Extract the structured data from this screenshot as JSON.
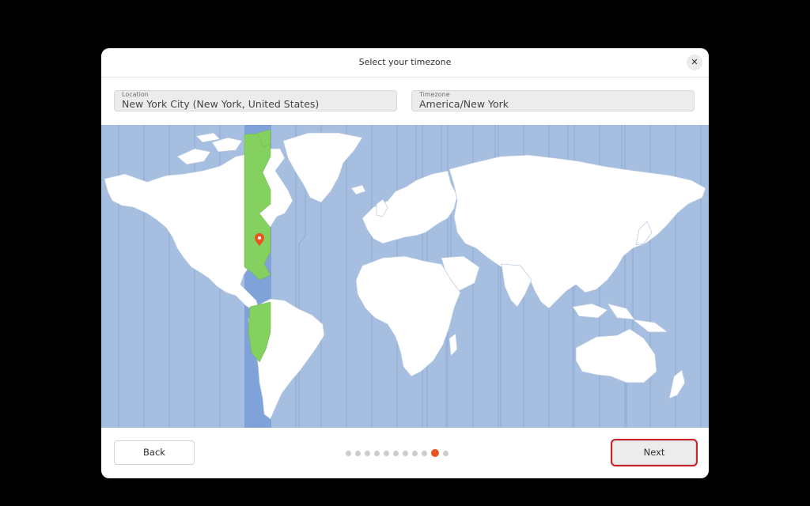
{
  "dialog": {
    "title": "Select your timezone",
    "close_icon": "close-icon"
  },
  "location": {
    "label": "Location",
    "value": "New York City (New York, United States)"
  },
  "timezone": {
    "label": "Timezone",
    "value": "America/New York"
  },
  "map": {
    "selected_marker_icon": "map-pin-icon",
    "colors": {
      "ocean": "#a6bfe0",
      "land": "#ffffff",
      "selected_zone_band": "#7b9fd8",
      "selected_zone_land": "#85d160",
      "marker": "#e95420"
    }
  },
  "footer": {
    "back_label": "Back",
    "next_label": "Next",
    "progress": {
      "total_steps": 11,
      "current_step": 10
    }
  },
  "colors": {
    "accent": "#e95420",
    "highlight_outline": "#d0202b"
  }
}
